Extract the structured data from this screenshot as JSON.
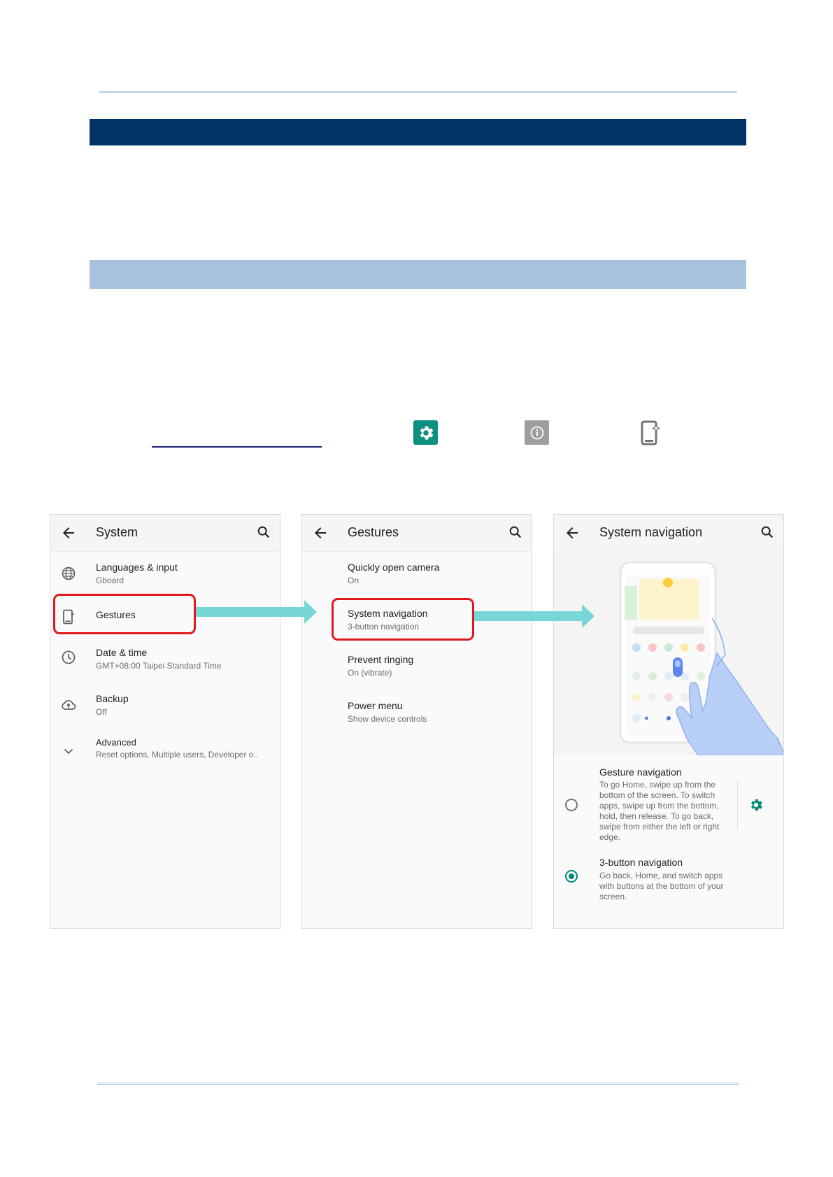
{
  "colors": {
    "header_band": "#003366",
    "subheader_band": "#a7c2df",
    "settings_tile": "#0b8f80",
    "info_tile": "#9e9e9e",
    "highlight": "#e0191e",
    "arrow": "#76d7d6",
    "accent": "#00897b"
  },
  "icons": {
    "settings_tile": "settings-gear-icon",
    "info_tile": "info-icon",
    "gesture_tile": "gestures-phone-icon"
  },
  "screens": {
    "system": {
      "title": "System",
      "items": [
        {
          "title": "Languages & input",
          "subtitle": "Gboard",
          "icon": "globe-icon"
        },
        {
          "title": "Gestures",
          "subtitle": "",
          "icon": "gestures-phone-icon"
        },
        {
          "title": "Date & time",
          "subtitle": "GMT+08:00 Taipei Standard Time",
          "icon": "clock-icon"
        },
        {
          "title": "Backup",
          "subtitle": "Off",
          "icon": "cloud-upload-icon"
        },
        {
          "title": "Advanced",
          "subtitle": "Reset options, Multiple users, Developer o..",
          "icon": "chevron-down-icon"
        }
      ]
    },
    "gestures": {
      "title": "Gestures",
      "items": [
        {
          "title": "Quickly open camera",
          "subtitle": "On"
        },
        {
          "title": "System navigation",
          "subtitle": "3-button navigation"
        },
        {
          "title": "Prevent ringing",
          "subtitle": "On (vibrate)"
        },
        {
          "title": "Power menu",
          "subtitle": "Show device controls"
        }
      ]
    },
    "system_navigation": {
      "title": "System navigation",
      "options": [
        {
          "title": "Gesture navigation",
          "description": "To go Home, swipe up from the bottom of the screen. To switch apps, swipe up from the bottom, hold, then release. To go back, swipe from either the left or right edge.",
          "selected": false
        },
        {
          "title": "3-button navigation",
          "description": "Go back, Home, and switch apps with buttons at the bottom of your screen.",
          "selected": true
        }
      ]
    }
  }
}
